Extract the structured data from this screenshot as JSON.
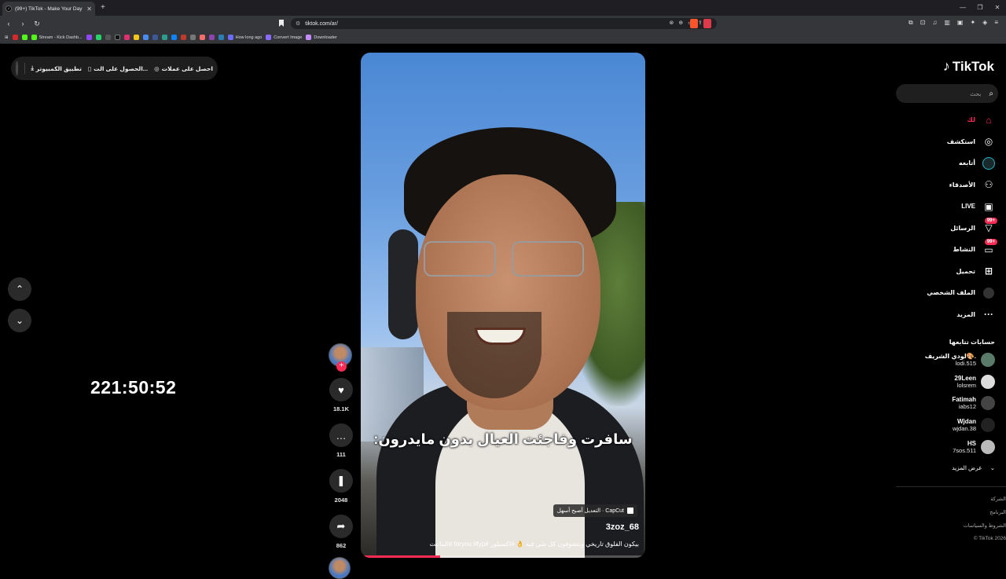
{
  "browser": {
    "tab_title": "(99+) TikTok - Make Your Day",
    "new_tab": "+",
    "url": "tiktok.com/ar/",
    "bookmarks": [
      {
        "label": "Stream - Kick Dashb...",
        "color": "#53fc18"
      },
      {
        "label": "How long ago",
        "color": "#6b6bff"
      },
      {
        "label": "Convert Image",
        "color": "#8a6bff"
      },
      {
        "label": "Downloader",
        "color": "#c28bff"
      }
    ]
  },
  "top_pill": {
    "item1": "احصل على عملات",
    "item2": "الحصول على الت...",
    "item3": "تطبيق الكمبيوتر"
  },
  "nav": {
    "up": "⌃",
    "down": "⌄"
  },
  "timer": "221:50:52",
  "video": {
    "caption": "سافرت وفاجئت العيال بدون مايدرون:",
    "capcut_label": "CapCut · التعديل أصبح أسهل",
    "username": "3zoz_68",
    "description": "بيكون الفلوق تاريخي وبتشوفون كل شي فيه 👌 #اكسبلور #foryou #fyp #البتابيت",
    "progress": 0.28
  },
  "actions": {
    "likes": "18.1K",
    "comments": "111",
    "saves": "2048",
    "shares": "862"
  },
  "sidebar": {
    "logo": "TikTok",
    "search_placeholder": "بحث",
    "menu": [
      {
        "label": "لك",
        "icon": "home-icon",
        "glyph": "⌂",
        "active": true
      },
      {
        "label": "استكشف",
        "icon": "compass-icon",
        "glyph": "◎"
      },
      {
        "label": "أتابعه",
        "icon": "following-icon",
        "glyph": ""
      },
      {
        "label": "الأصدقاء",
        "icon": "friends-icon",
        "glyph": "👥"
      },
      {
        "label": "LIVE",
        "icon": "live-icon",
        "glyph": "▣"
      },
      {
        "label": "الرسائل",
        "icon": "messages-icon",
        "glyph": "▽",
        "badge": "99+"
      },
      {
        "label": "النشاط",
        "icon": "activity-icon",
        "glyph": "▭",
        "badge": "99+"
      },
      {
        "label": "تحميل",
        "icon": "upload-icon",
        "glyph": "⊞"
      },
      {
        "label": "الملف الشخصي",
        "icon": "profile-icon",
        "glyph": ""
      },
      {
        "label": "المزيد",
        "icon": "more-icon",
        "glyph": "···"
      }
    ],
    "following_title": "حسابات تتابعها",
    "following": [
      {
        "name": "لودي الشريف🎨.",
        "handle": "lodi.515"
      },
      {
        "name": "29Leen",
        "handle": "lolsrem"
      },
      {
        "name": "Fatimah",
        "handle": "iabs12"
      },
      {
        "name": "Wjdan",
        "handle": "wjdan.38"
      },
      {
        "name": "HS",
        "handle": "7sos.511"
      }
    ],
    "see_more": "عرض المزيد",
    "footer": [
      "الشركة",
      "البرنامج",
      "الشروط والسياسات",
      "© TikTok 2026"
    ]
  },
  "colors": {
    "accent": "#fe2c55",
    "background": "#000000"
  }
}
